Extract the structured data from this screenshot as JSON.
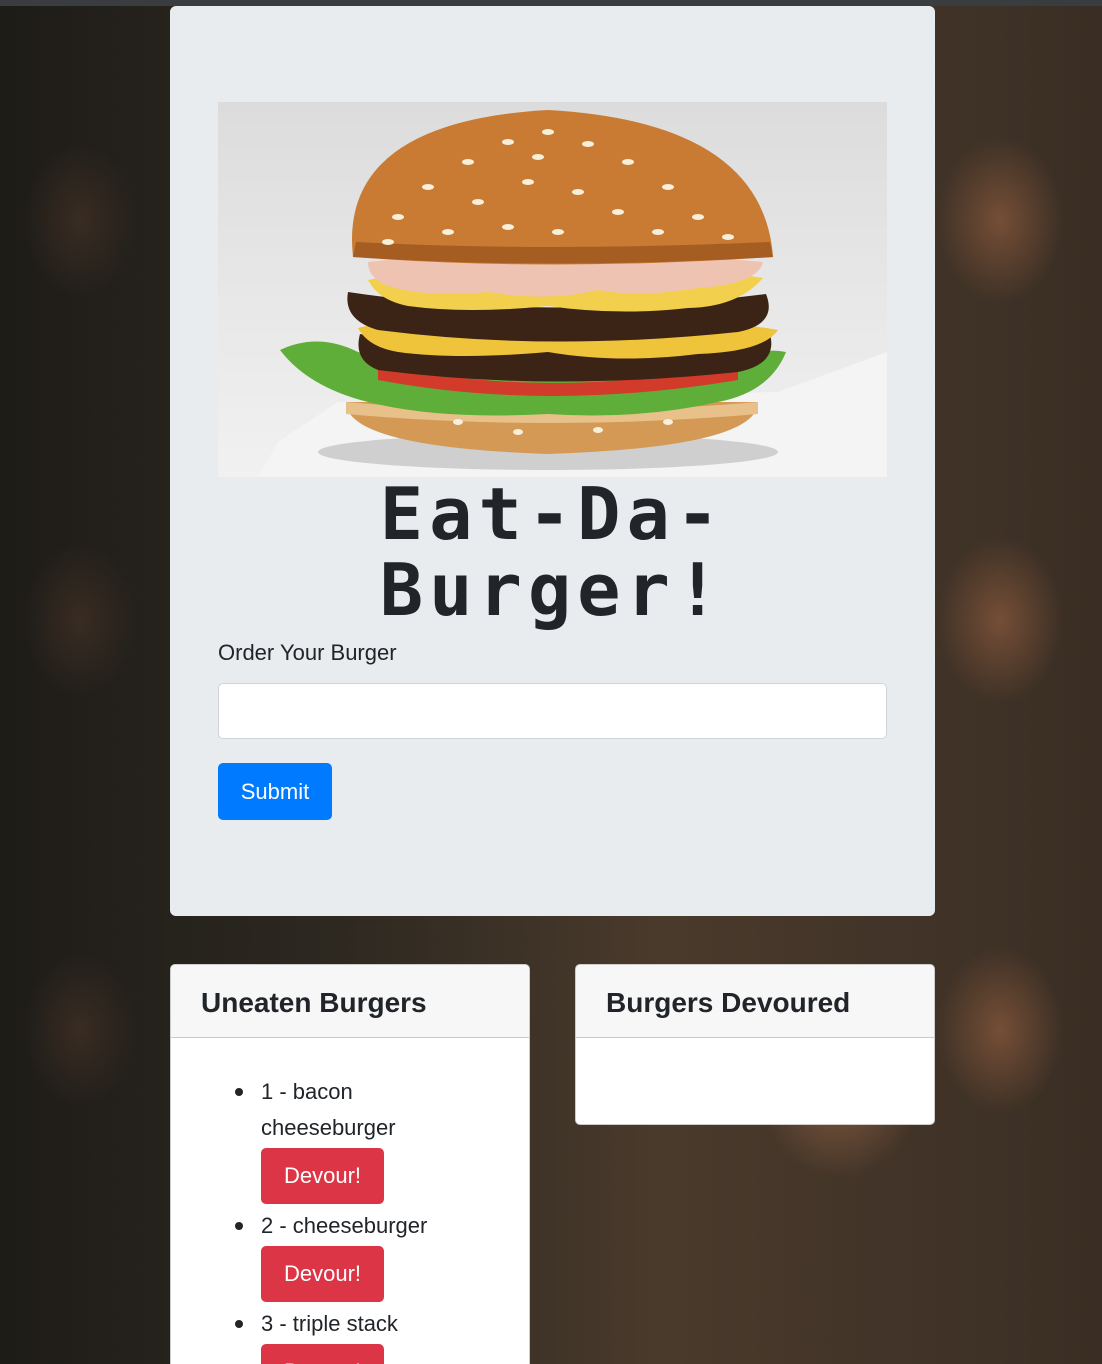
{
  "header": {
    "title_line1": "Eat-Da-",
    "title_line2": "Burger!"
  },
  "form": {
    "label": "Order Your Burger",
    "input_value": "",
    "submit_label": "Submit"
  },
  "uneaten": {
    "heading": "Uneaten Burgers",
    "items": [
      {
        "text": "1 - bacon cheeseburger",
        "button": "Devour!"
      },
      {
        "text": "2 - cheeseburger",
        "button": "Devour!"
      },
      {
        "text": "3 - triple stack",
        "button": "Devour!"
      }
    ]
  },
  "devoured": {
    "heading": "Burgers Devoured",
    "items": []
  },
  "colors": {
    "primary": "#007bff",
    "danger": "#dc3545",
    "jumbotron": "#e9ecef"
  }
}
